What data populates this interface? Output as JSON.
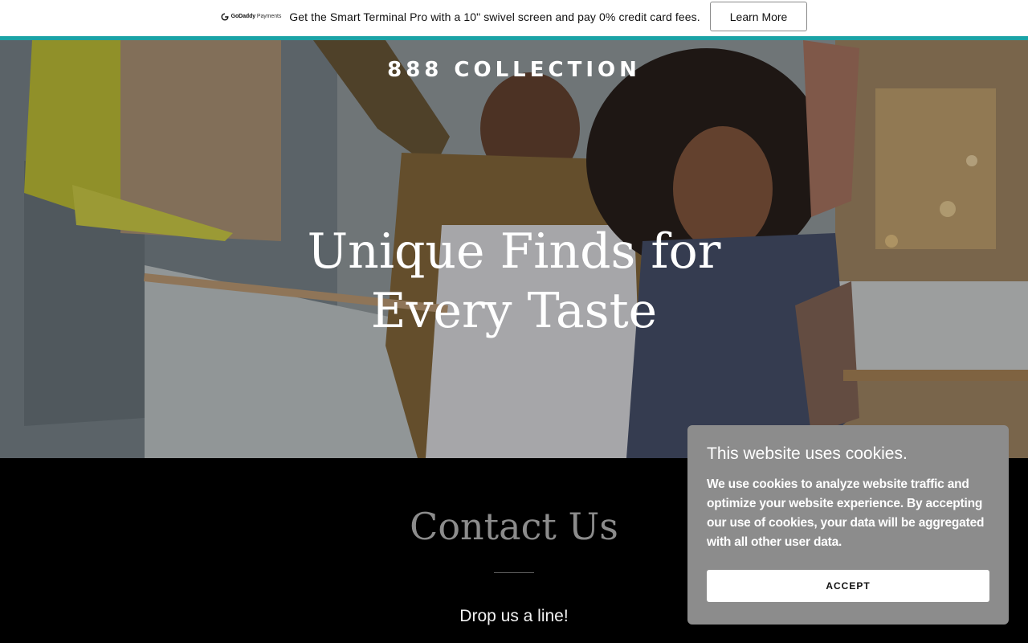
{
  "promo": {
    "brand_primary": "GoDaddy",
    "brand_secondary": "Payments",
    "text": "Get the Smart Terminal Pro with a 10\" swivel screen and pay 0% credit card fees.",
    "button_label": "Learn More",
    "accent_color": "#1ba3a6"
  },
  "hero": {
    "site_title": "888 COLLECTION",
    "heading": "Unique Finds for Every Taste"
  },
  "contact": {
    "title": "Contact Us",
    "subtitle": "Drop us a line!"
  },
  "cookie_banner": {
    "title": "This website uses cookies.",
    "body": "We use cookies to analyze website traffic and optimize your website experience. By accepting our use of cookies, your data will be aggregated with all other user data.",
    "accept_label": "ACCEPT"
  },
  "icons": {
    "brand_logo": "godaddy-logo-icon"
  }
}
